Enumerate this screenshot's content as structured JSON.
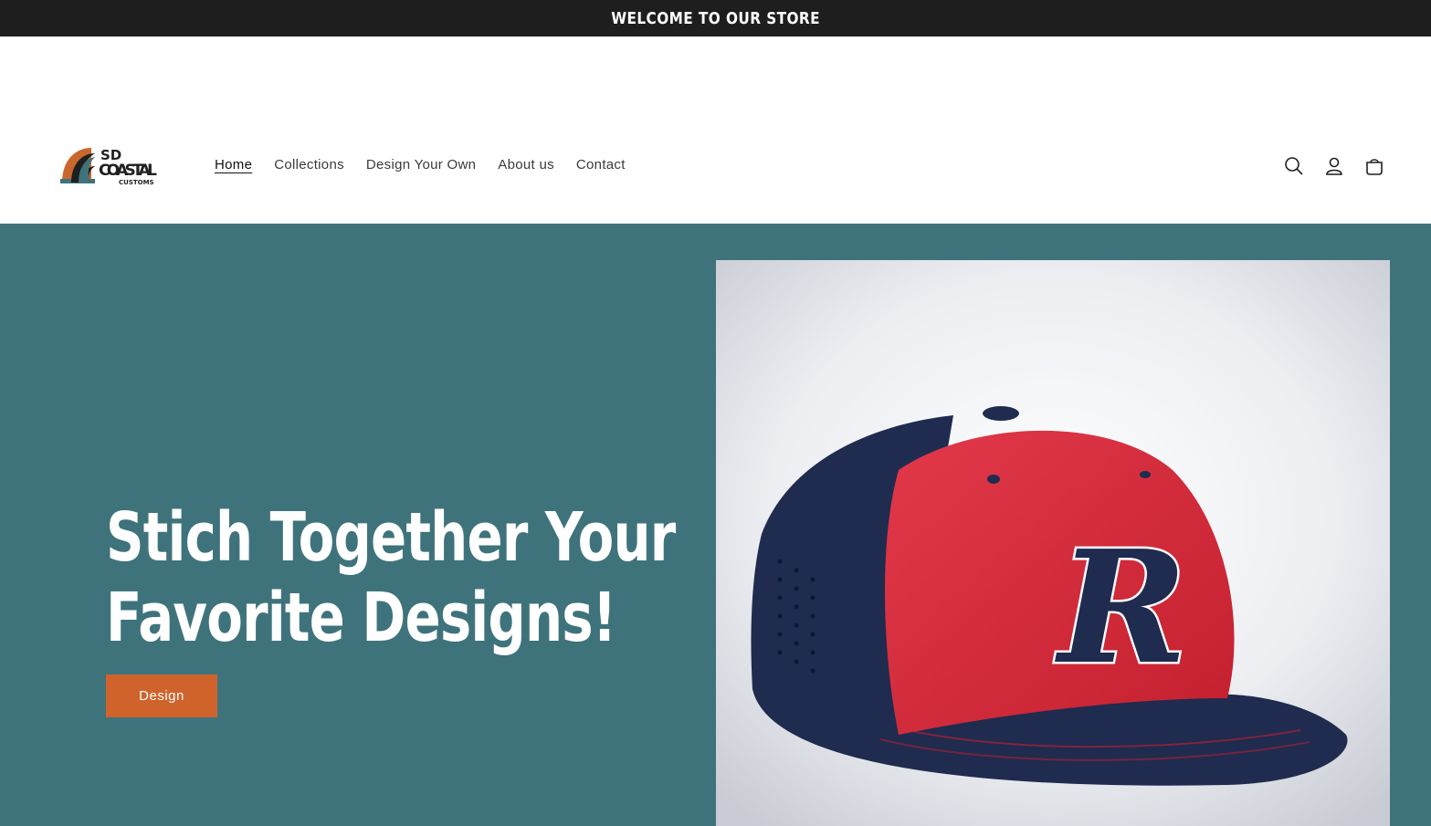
{
  "announcement": {
    "text": "WELCOME TO OUR STORE"
  },
  "logo": {
    "line1": "SD",
    "line2": "COASTAL",
    "line3": "CUSTOMS"
  },
  "nav": {
    "items": [
      {
        "label": "Home",
        "active": true
      },
      {
        "label": "Collections"
      },
      {
        "label": "Design Your Own"
      },
      {
        "label": "About us"
      },
      {
        "label": "Contact"
      }
    ]
  },
  "header_icons": [
    "search-icon",
    "account-icon",
    "cart-icon"
  ],
  "hero": {
    "title_line1": "Stich Together Your",
    "title_line2": "Favorite Designs!",
    "button_label": "Design",
    "image_letter": "R"
  },
  "colors": {
    "announcement_bg": "#1e1e1e",
    "hero_bg": "#3f737c",
    "button_bg": "#d0632c",
    "cap_red": "#d42c3c",
    "cap_navy": "#1f2b4f"
  }
}
